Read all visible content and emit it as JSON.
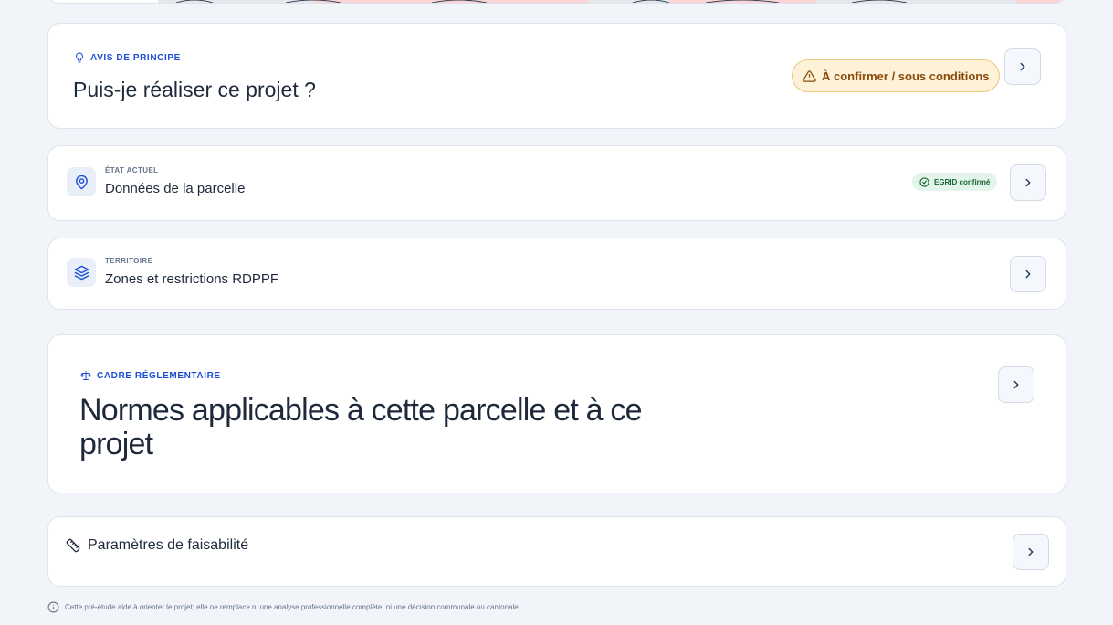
{
  "avis": {
    "eyebrow": "AVIS DE PRINCIPE",
    "title": "Puis-je réaliser ce projet ?",
    "badge": "À confirmer / sous conditions"
  },
  "parcelle": {
    "eyebrow": "ÉTAT ACTUEL",
    "title": "Données de la parcelle",
    "badge": "EGRID confirmé"
  },
  "territoire": {
    "eyebrow": "TERRITOIRE",
    "title": "Zones et restrictions RDPPF"
  },
  "cadre": {
    "eyebrow": "CADRE RÉGLEMENTAIRE",
    "title": "Normes applicables à cette parcelle et à ce projet"
  },
  "faisabilite": {
    "title": "Paramètres de faisabilité"
  },
  "footer": {
    "note": "Cette pré-étude aide à orienter le projet; elle ne remplace ni une analyse professionnelle complète, ni une décision communale ou cantonale."
  },
  "colors": {
    "accent": "#1d4ed8",
    "warning_bg": "#fdf1d8",
    "warning_text": "#8a4b0b",
    "success_bg": "#e3f5ea",
    "success_text": "#166534"
  }
}
